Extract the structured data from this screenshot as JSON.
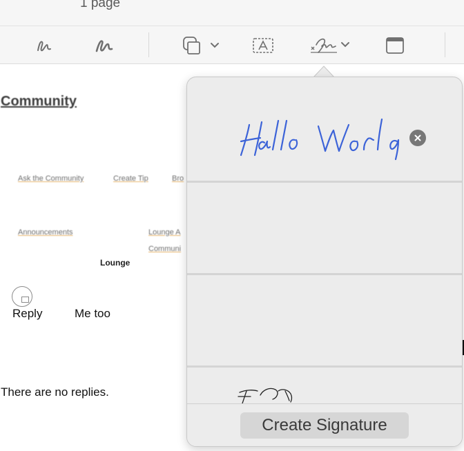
{
  "titlebar": {
    "page_count": "1 page"
  },
  "toolbar": {
    "icons": [
      "sketch-icon",
      "draw-icon",
      "shapes-icon",
      "text-box-icon",
      "sign-icon",
      "window-icon"
    ]
  },
  "document": {
    "title": "Community",
    "links": [
      "Ask the Community",
      "Create Tip",
      "Bro",
      "Announcements",
      "Lounge A",
      "Communi"
    ],
    "lounge_label": "Lounge",
    "reply_label": "Reply",
    "me_too_label": "Me too",
    "no_replies": "There are no replies."
  },
  "signature_popover": {
    "signatures": [
      {
        "content": "Hallo World (handwritten)"
      },
      {
        "content": ""
      },
      {
        "content": ""
      },
      {
        "content": "handwritten signature (partially visible)"
      }
    ],
    "create_button": "Create Signature",
    "ink_color": "#3c63d8"
  }
}
